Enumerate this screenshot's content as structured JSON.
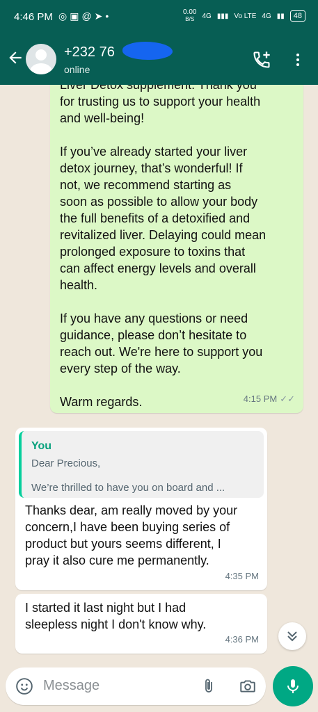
{
  "status_bar": {
    "time": "4:46 PM",
    "notification_icons": [
      "whatsapp-icon",
      "message-icon",
      "threads-icon",
      "telegram-icon",
      "dot-icon"
    ],
    "data_speed_value": "0.00",
    "data_speed_unit": "B/S",
    "network_1": "4G",
    "network_2": "Vo LTE",
    "network_3": "4G",
    "battery": "48"
  },
  "header": {
    "contact_name": "+232 76",
    "contact_status": "online"
  },
  "messages": [
    {
      "id": "m1",
      "direction": "outgoing",
      "text": "Liver Detox supplement. Thank you\nfor trusting us to support your health\nand well-being!\n\nIf you’ve already started your liver\ndetox journey, that’s wonderful! If\nnot, we recommend starting as\nsoon as possible to allow your body\nthe full benefits of a detoxified and\nrevitalized liver. Delaying could mean\nprolonged exposure to toxins that\ncan affect energy levels and overall\nhealth.\n\nIf you have any questions or need\nguidance, please don’t hesitate to\nreach out. We're here to support you\nevery step of the way.\n\nWarm regards.",
      "time": "4:15 PM"
    },
    {
      "id": "m2",
      "direction": "incoming",
      "quote_author": "You",
      "quote_line1": "Dear  Precious,",
      "quote_line2": "We’re thrilled to have you on board and ...",
      "text": "Thanks dear, am really moved by your\nconcern,I have been buying series of\nproduct but yours seems different, I\npray it also cure me permanently.",
      "time": "4:35 PM"
    },
    {
      "id": "m3",
      "direction": "incoming",
      "text": "I started it last night but I had\nsleepless night I don't know why.",
      "time": "4:36 PM"
    }
  ],
  "composer": {
    "placeholder": "Message"
  },
  "colors": {
    "header": "#075e54",
    "outgoing_bubble": "#dcf8c6",
    "incoming_bubble": "#ffffff",
    "accent": "#00a884",
    "chat_background": "#efe7dc"
  }
}
